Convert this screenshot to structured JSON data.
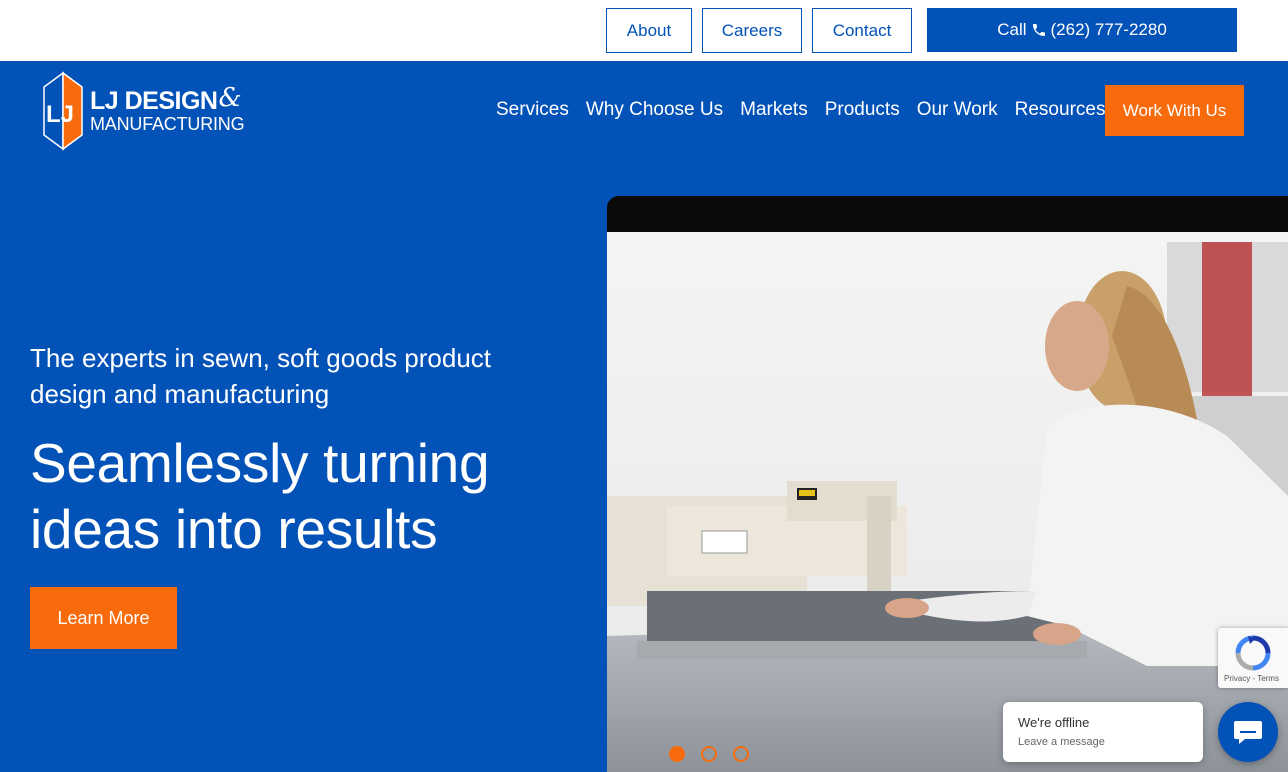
{
  "topbar": {
    "about": "About",
    "careers": "Careers",
    "contact": "Contact",
    "call_label": "Call",
    "phone": "(262) 777-2280"
  },
  "logo": {
    "line1": "LJ DESIGN",
    "amp": "&",
    "line2": "MANUFACTURING",
    "mark": "LJ"
  },
  "nav": {
    "items": [
      "Services",
      "Why Choose Us",
      "Markets",
      "Products",
      "Our Work",
      "Resources"
    ],
    "cta": "Work With Us"
  },
  "hero": {
    "subtitle": "The experts in sewn, soft goods product design and manufacturing",
    "title": "Seamlessly turning ideas into results",
    "button": "Learn More"
  },
  "carousel": {
    "slides": 3,
    "active": 1
  },
  "recaptcha": {
    "links": "Privacy - Terms"
  },
  "chat": {
    "status": "We're offline",
    "message": "Leave a message"
  },
  "colors": {
    "brand_blue": "#0352b8",
    "accent_orange": "#f86b0c",
    "white": "#ffffff"
  }
}
